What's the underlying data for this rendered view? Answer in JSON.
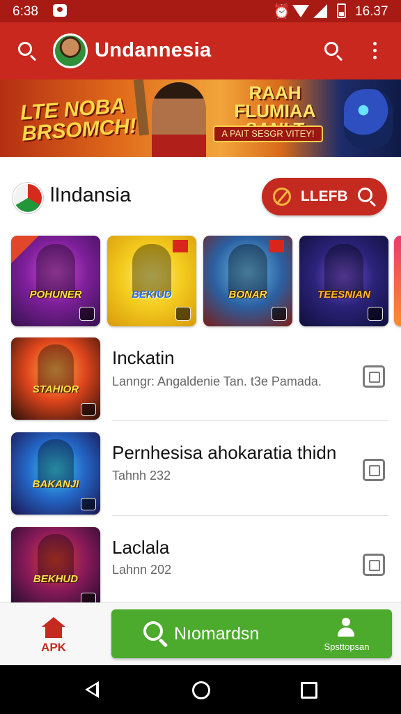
{
  "status_bar": {
    "time": "6:38",
    "battery_text": "16.37",
    "icons": [
      "notification-icon",
      "alarm-icon",
      "wifi-icon",
      "signal-icon",
      "battery-icon"
    ]
  },
  "app_bar": {
    "title": "Undannesia",
    "icons": [
      "search-icon",
      "avatar",
      "search-icon",
      "more-vert-icon"
    ],
    "color": "#c8281e"
  },
  "banner": {
    "left_text_line1": "LTE NOBA",
    "left_text_line2": "BRSOMCH!",
    "right_title_line1": "RAAH",
    "right_title_line2": "FLUMIAA SANLT",
    "tagline": "A PAIT SESGR VITEY!"
  },
  "section": {
    "title": "lIndansia",
    "button_label": "LLEFB"
  },
  "game_tiles": [
    {
      "label": "POHUNER"
    },
    {
      "label": "BEKIUD"
    },
    {
      "label": "BONAR"
    },
    {
      "label": "TEESNIAN"
    }
  ],
  "list_items": [
    {
      "title": "Inckatin",
      "subtitle": "Lanngr: Angaldenie Tan. t3e Pamada.",
      "thumb_label": "STAHIOR"
    },
    {
      "title": "Pernhesisa ahokaratia thidn",
      "subtitle": "Tahnh 232",
      "thumb_label": "BAKANJI"
    },
    {
      "title": "Laclala",
      "subtitle": "Lahnn 202",
      "thumb_label": "BEKHUD"
    }
  ],
  "bottom_bar": {
    "apk_label": "APK",
    "main_action_label": "Nıomardsn",
    "user_label": "Spsttopsan",
    "main_action_color": "#4caa2c",
    "accent_color": "#c42a1f"
  },
  "nav_bar": {
    "icons": [
      "back-icon",
      "home-icon",
      "recent-apps-icon"
    ]
  }
}
